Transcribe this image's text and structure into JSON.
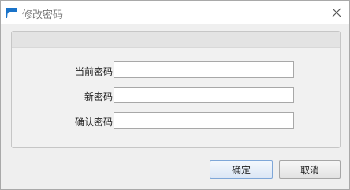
{
  "window": {
    "title": "修改密码",
    "app_icon": "app-logo-icon",
    "close_icon": "close-icon",
    "accent_color": "#1a73c9"
  },
  "form": {
    "fields": [
      {
        "label": "当前密码",
        "value": "",
        "placeholder": ""
      },
      {
        "label": "新密码",
        "value": "",
        "placeholder": ""
      },
      {
        "label": "确认密码",
        "value": "",
        "placeholder": ""
      }
    ]
  },
  "buttons": {
    "ok_label": "确定",
    "cancel_label": "取消"
  }
}
